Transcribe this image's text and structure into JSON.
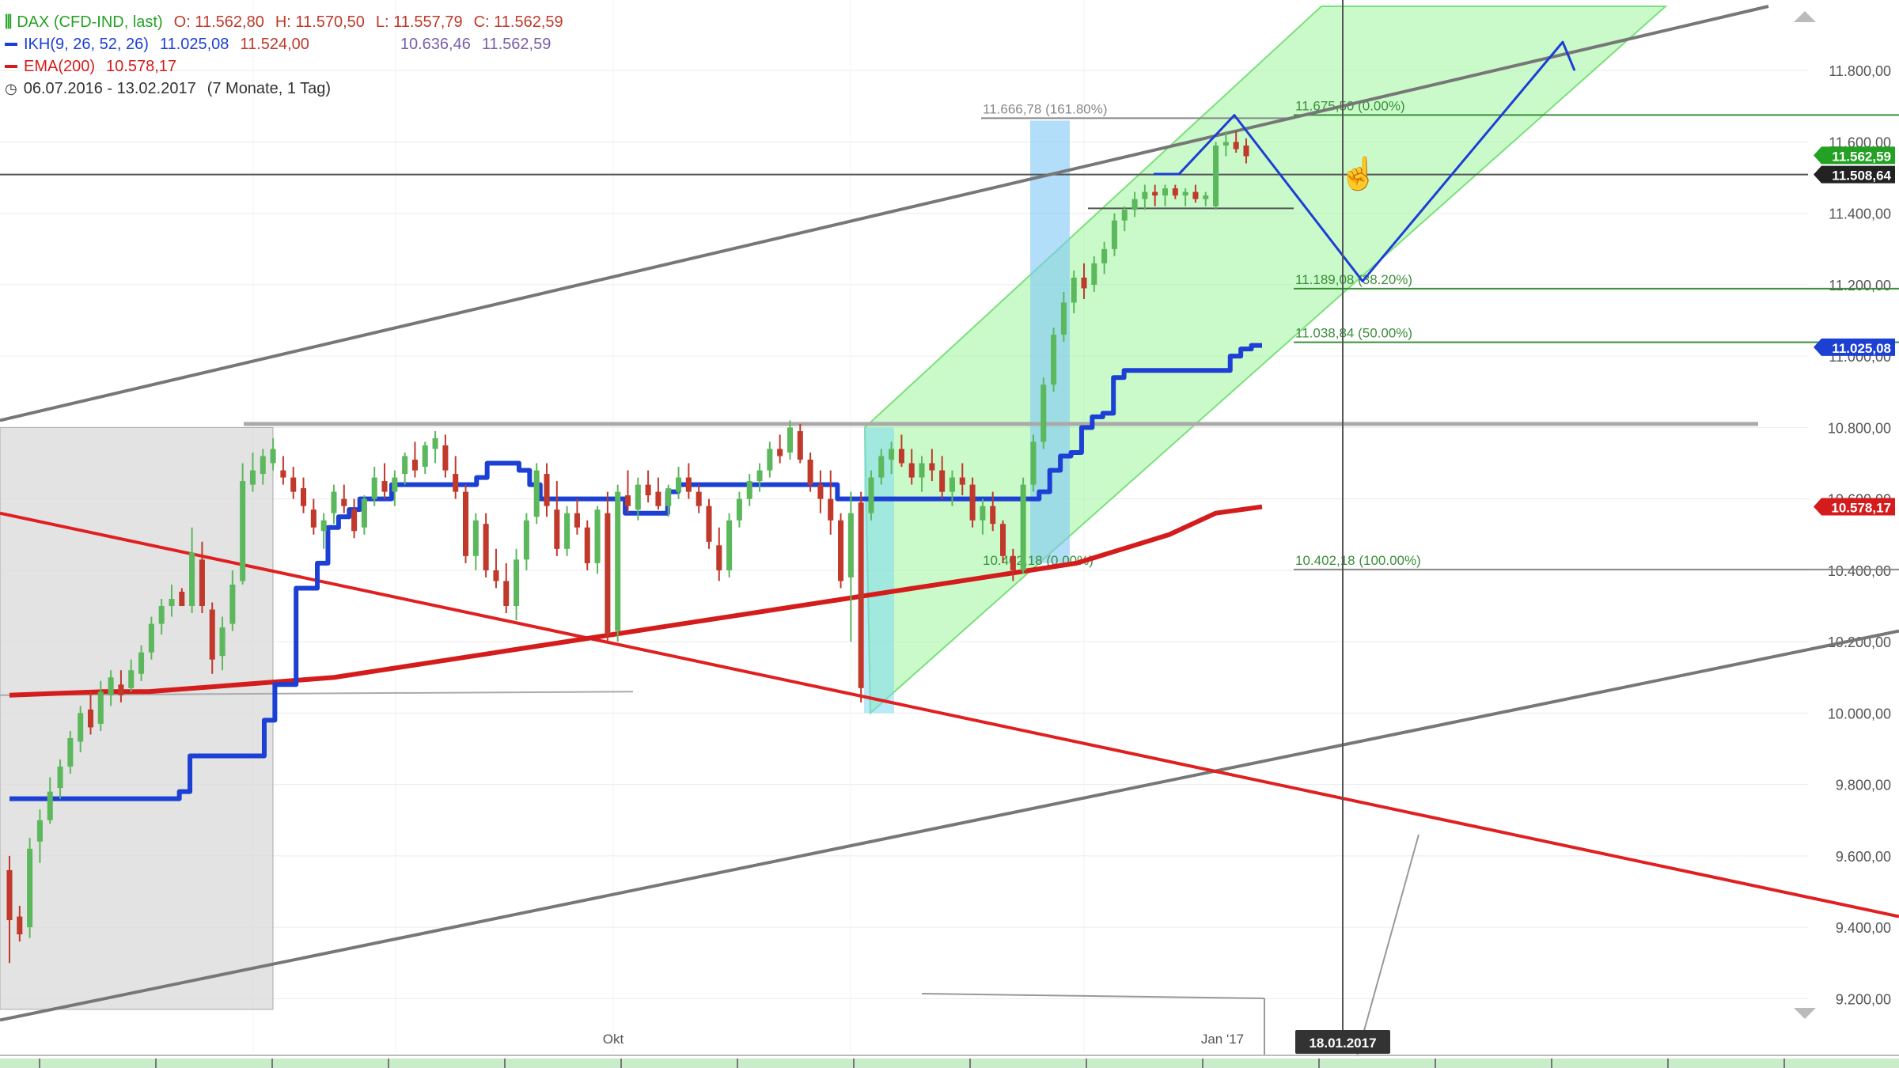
{
  "legend": {
    "dax": {
      "label": "DAX (CFD-IND, last)",
      "o": "O: 11.562,80",
      "h": "H: 11.570,50",
      "l": "L: 11.557,79",
      "c": "C: 11.562,59",
      "color": "#26a326"
    },
    "ikh": {
      "label": "IKH(9, 26, 52, 26)",
      "v1": "11.025,08",
      "v2": "11.524,00",
      "v3": "10.636,46",
      "v4": "11.562,59",
      "color": "#1c3fd4"
    },
    "ema": {
      "label": "EMA(200)",
      "v1": "10.578,17",
      "color": "#d41c1c"
    },
    "period": {
      "range": "06.07.2016 - 13.02.2017",
      "span": "(7 Monate, 1 Tag)"
    }
  },
  "chart_data": {
    "type": "candlestick",
    "ylim": [
      9050,
      11980
    ],
    "y_ticks": [
      "11.800,00",
      "11.600,00",
      "11.400,00",
      "11.200,00",
      "11.000,00",
      "10.800,00",
      "10.600,00",
      "10.400,00",
      "10.200,00",
      "10.000,00",
      "9.800,00",
      "9.600,00",
      "9.400,00",
      "9.200,00"
    ],
    "y_tick_values": [
      11800,
      11600,
      11400,
      11200,
      11000,
      10800,
      10600,
      10400,
      10200,
      10000,
      9800,
      9600,
      9400,
      9200
    ],
    "x_labels": [
      "Okt",
      "Jan '17"
    ],
    "price_badges": [
      {
        "text": "11.562,59",
        "value": 11562.59,
        "color": "#23a123"
      },
      {
        "text": "11.508,64",
        "value": 11508.64,
        "color": "#222222"
      },
      {
        "text": "11.025,08",
        "value": 11025.08,
        "color": "#1c3fd4"
      },
      {
        "text": "10.578,17",
        "value": 10578.17,
        "color": "#d41c1c"
      }
    ],
    "crosshair_date": "18.01.2017",
    "fib_levels": [
      {
        "label": "11.666,78 (161.80%)",
        "value": 11666.78
      },
      {
        "label": "11.675,50 (0.00%)",
        "value": 11675.5
      },
      {
        "label": "11.189,08 (38.20%)",
        "value": 11189.08
      },
      {
        "label": "11.038,84 (50.00%)",
        "value": 11038.84
      },
      {
        "label": "10.402,18 (100.00%)",
        "value": 10402.18
      },
      {
        "label": "10.402,18 (0.00%)",
        "value": 10402.18
      }
    ],
    "horizontal_levels": [
      11508.64,
      10810,
      11414
    ],
    "candles": [
      [
        9560,
        9600,
        9300,
        9420
      ],
      [
        9430,
        9460,
        9360,
        9380
      ],
      [
        9400,
        9650,
        9370,
        9620
      ],
      [
        9640,
        9730,
        9580,
        9700
      ],
      [
        9700,
        9820,
        9690,
        9780
      ],
      [
        9790,
        9870,
        9760,
        9850
      ],
      [
        9850,
        9950,
        9830,
        9930
      ],
      [
        9920,
        10020,
        9890,
        10000
      ],
      [
        10010,
        10060,
        9940,
        9960
      ],
      [
        9970,
        10090,
        9950,
        10060
      ],
      [
        10050,
        10120,
        10020,
        10100
      ],
      [
        10080,
        10120,
        10030,
        10050
      ],
      [
        10070,
        10150,
        10060,
        10120
      ],
      [
        10110,
        10190,
        10090,
        10170
      ],
      [
        10170,
        10270,
        10150,
        10250
      ],
      [
        10250,
        10320,
        10220,
        10300
      ],
      [
        10300,
        10360,
        10270,
        10320
      ],
      [
        10340,
        10350,
        10300,
        10300
      ],
      [
        10300,
        10520,
        10280,
        10450
      ],
      [
        10430,
        10480,
        10280,
        10300
      ],
      [
        10290,
        10310,
        10110,
        10150
      ],
      [
        10160,
        10270,
        10120,
        10240
      ],
      [
        10250,
        10400,
        10230,
        10360
      ],
      [
        10370,
        10700,
        10360,
        10650
      ],
      [
        10640,
        10730,
        10620,
        10680
      ],
      [
        10670,
        10740,
        10640,
        10720
      ],
      [
        10700,
        10770,
        10680,
        10740
      ],
      [
        10680,
        10720,
        10640,
        10660
      ],
      [
        10660,
        10690,
        10600,
        10620
      ],
      [
        10630,
        10660,
        10560,
        10580
      ],
      [
        10570,
        10600,
        10500,
        10520
      ],
      [
        10510,
        10560,
        10460,
        10540
      ],
      [
        10560,
        10640,
        10530,
        10620
      ],
      [
        10600,
        10640,
        10560,
        10580
      ],
      [
        10570,
        10600,
        10490,
        10510
      ],
      [
        10520,
        10610,
        10500,
        10600
      ],
      [
        10600,
        10690,
        10580,
        10660
      ],
      [
        10650,
        10700,
        10600,
        10620
      ],
      [
        10620,
        10680,
        10580,
        10660
      ],
      [
        10670,
        10730,
        10640,
        10720
      ],
      [
        10710,
        10760,
        10660,
        10680
      ],
      [
        10690,
        10760,
        10670,
        10750
      ],
      [
        10740,
        10790,
        10700,
        10770
      ],
      [
        10750,
        10780,
        10660,
        10680
      ],
      [
        10670,
        10720,
        10600,
        10620
      ],
      [
        10620,
        10640,
        10420,
        10440
      ],
      [
        10440,
        10560,
        10400,
        10540
      ],
      [
        10530,
        10560,
        10380,
        10400
      ],
      [
        10400,
        10460,
        10350,
        10370
      ],
      [
        10370,
        10420,
        10280,
        10300
      ],
      [
        10300,
        10460,
        10260,
        10430
      ],
      [
        10430,
        10560,
        10400,
        10540
      ],
      [
        10550,
        10700,
        10530,
        10680
      ],
      [
        10670,
        10700,
        10550,
        10580
      ],
      [
        10570,
        10650,
        10440,
        10460
      ],
      [
        10460,
        10580,
        10440,
        10560
      ],
      [
        10560,
        10600,
        10500,
        10520
      ],
      [
        10520,
        10540,
        10400,
        10420
      ],
      [
        10420,
        10580,
        10390,
        10570
      ],
      [
        10560,
        10620,
        10200,
        10220
      ],
      [
        10230,
        10640,
        10200,
        10620
      ],
      [
        10610,
        10680,
        10560,
        10580
      ],
      [
        10570,
        10660,
        10540,
        10640
      ],
      [
        10640,
        10680,
        10590,
        10610
      ],
      [
        10620,
        10660,
        10570,
        10580
      ],
      [
        10580,
        10640,
        10550,
        10630
      ],
      [
        10620,
        10690,
        10600,
        10660
      ],
      [
        10660,
        10700,
        10600,
        10620
      ],
      [
        10620,
        10640,
        10560,
        10580
      ],
      [
        10580,
        10600,
        10460,
        10480
      ],
      [
        10470,
        10520,
        10370,
        10400
      ],
      [
        10400,
        10560,
        10380,
        10540
      ],
      [
        10540,
        10620,
        10520,
        10600
      ],
      [
        10600,
        10670,
        10580,
        10650
      ],
      [
        10650,
        10700,
        10620,
        10680
      ],
      [
        10680,
        10760,
        10660,
        10740
      ],
      [
        10740,
        10780,
        10700,
        10720
      ],
      [
        10730,
        10820,
        10710,
        10800
      ],
      [
        10790,
        10810,
        10700,
        10710
      ],
      [
        10710,
        10730,
        10620,
        10640
      ],
      [
        10640,
        10680,
        10560,
        10600
      ],
      [
        10600,
        10680,
        10500,
        10540
      ],
      [
        10540,
        10560,
        10350,
        10370
      ],
      [
        10380,
        10620,
        10200,
        10560
      ],
      [
        10590,
        10620,
        10030,
        10070
      ],
      [
        10560,
        10680,
        10540,
        10660
      ],
      [
        10660,
        10740,
        10640,
        10720
      ],
      [
        10710,
        10760,
        10670,
        10740
      ],
      [
        10740,
        10780,
        10690,
        10700
      ],
      [
        10700,
        10740,
        10640,
        10660
      ],
      [
        10660,
        10720,
        10620,
        10700
      ],
      [
        10700,
        10740,
        10650,
        10680
      ],
      [
        10680,
        10720,
        10600,
        10620
      ],
      [
        10620,
        10680,
        10580,
        10660
      ],
      [
        10660,
        10700,
        10610,
        10640
      ],
      [
        10640,
        10660,
        10520,
        10540
      ],
      [
        10540,
        10600,
        10500,
        10580
      ],
      [
        10580,
        10620,
        10510,
        10530
      ],
      [
        10530,
        10540,
        10420,
        10440
      ],
      [
        10440,
        10460,
        10370,
        10400
      ],
      [
        10400,
        10660,
        10390,
        10640
      ],
      [
        10640,
        10780,
        10620,
        10760
      ],
      [
        10760,
        10940,
        10740,
        10920
      ],
      [
        10920,
        11080,
        10900,
        11060
      ],
      [
        11060,
        11180,
        11040,
        11150
      ],
      [
        11150,
        11240,
        11120,
        11220
      ],
      [
        11220,
        11260,
        11160,
        11190
      ],
      [
        11200,
        11280,
        11180,
        11260
      ],
      [
        11260,
        11320,
        11230,
        11300
      ],
      [
        11300,
        11400,
        11280,
        11380
      ],
      [
        11380,
        11420,
        11350,
        11410
      ],
      [
        11410,
        11460,
        11390,
        11440
      ],
      [
        11440,
        11480,
        11410,
        11460
      ],
      [
        11460,
        11480,
        11420,
        11450
      ],
      [
        11450,
        11480,
        11420,
        11470
      ],
      [
        11470,
        11480,
        11440,
        11450
      ],
      [
        11450,
        11470,
        11420,
        11460
      ],
      [
        11460,
        11480,
        11430,
        11440
      ],
      [
        11440,
        11460,
        11420,
        11450
      ],
      [
        11420,
        11600,
        11410,
        11590
      ],
      [
        11590,
        11630,
        11560,
        11600
      ],
      [
        11600,
        11630,
        11570,
        11580
      ],
      [
        11590,
        11610,
        11540,
        11560
      ]
    ],
    "ikh_line": [
      9760,
      9760,
      9760,
      9760,
      9760,
      9760,
      9760,
      9760,
      9760,
      9760,
      9760,
      9760,
      9760,
      9760,
      9760,
      9760,
      9780,
      9880,
      9880,
      9880,
      9880,
      9880,
      9880,
      9880,
      9980,
      10080,
      10080,
      10350,
      10350,
      10420,
      10520,
      10550,
      10570,
      10600,
      10600,
      10600,
      10640,
      10640,
      10640,
      10640,
      10640,
      10640,
      10640,
      10640,
      10660,
      10700,
      10700,
      10700,
      10680,
      10640,
      10600,
      10600,
      10600,
      10600,
      10600,
      10600,
      10600,
      10600,
      10560,
      10560,
      10560,
      10560,
      10620,
      10640,
      10640,
      10640,
      10640,
      10640,
      10640,
      10640,
      10640,
      10640,
      10640,
      10640,
      10640,
      10640,
      10640,
      10640,
      10600,
      10600,
      10600,
      10600,
      10600,
      10600,
      10600,
      10600,
      10600,
      10600,
      10600,
      10600,
      10600,
      10600,
      10600,
      10600,
      10600,
      10600,
      10600,
      10620,
      10680,
      10720,
      10730,
      10800,
      10830,
      10840,
      10940,
      10960,
      10960,
      10960,
      10960,
      10960,
      10960,
      10960,
      10960,
      10960,
      10960,
      11000,
      11020,
      11030,
      11030
    ],
    "ema_line": [
      10050,
      10055,
      10060,
      10060,
      10070,
      10080,
      10090,
      10100,
      10120,
      10140,
      10160,
      10180,
      10200,
      10220,
      10240,
      10260,
      10280,
      10300,
      10320,
      10340,
      10360,
      10380,
      10400,
      10420,
      10460,
      10500,
      10560,
      10578
    ],
    "series": [
      {
        "name": "DAX (CFD-IND, last)",
        "type": "candle",
        "color": "#26a326"
      },
      {
        "name": "IKH(9, 26, 52, 26)",
        "type": "line",
        "color": "#1c3fd4"
      },
      {
        "name": "EMA(200)",
        "type": "line",
        "color": "#d41c1c"
      }
    ]
  }
}
